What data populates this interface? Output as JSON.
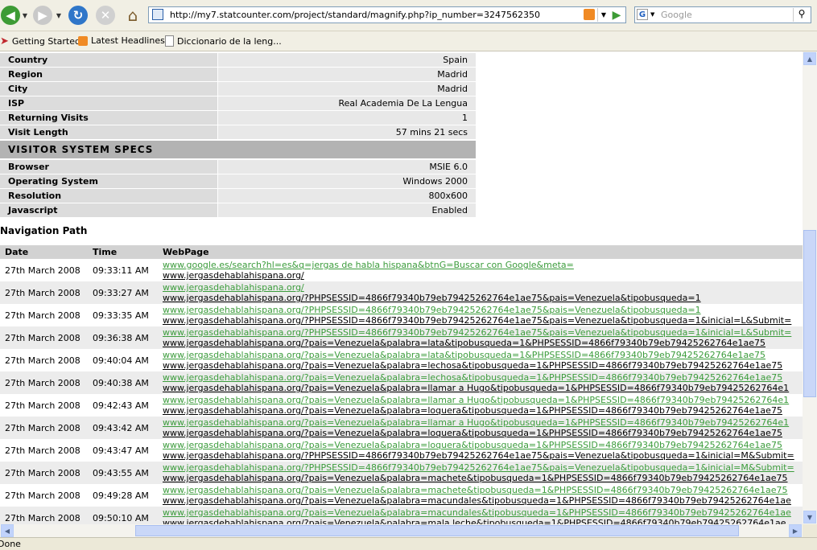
{
  "browser": {
    "url": "http://my7.statcounter.com/project/standard/magnify.php?ip_number=3247562350",
    "search_placeholder": "Google",
    "bookmarks": [
      "Getting Started",
      "Latest Headlines",
      "Diccionario de la leng..."
    ],
    "status": "Done"
  },
  "visitor_info": [
    {
      "label": "Country",
      "value": "Spain"
    },
    {
      "label": "Region",
      "value": "Madrid"
    },
    {
      "label": "City",
      "value": "Madrid"
    },
    {
      "label": "ISP",
      "value": "Real Academia De La Lengua"
    },
    {
      "label": "Returning Visits",
      "value": "1"
    },
    {
      "label": "Visit Length",
      "value": "57 mins 21 secs"
    }
  ],
  "system_specs": {
    "title": "VISITOR SYSTEM SPECS",
    "rows": [
      {
        "label": "Browser",
        "value": "MSIE 6.0"
      },
      {
        "label": "Operating System",
        "value": "Windows 2000"
      },
      {
        "label": "Resolution",
        "value": "800x600"
      },
      {
        "label": "Javascript",
        "value": "Enabled"
      }
    ]
  },
  "navigation": {
    "title": "Navigation Path",
    "columns": [
      "Date",
      "Time",
      "WebPage"
    ],
    "rows": [
      {
        "date": "27th March 2008",
        "time": "09:33:11 AM",
        "link1": "www.google.es/search?hl=es&q=jergas de habla hispana&btnG=Buscar con Google&meta=",
        "link2": "www.jergasdehablahispana.org/"
      },
      {
        "date": "27th March 2008",
        "time": "09:33:27 AM",
        "link1": "www.jergasdehablahispana.org/",
        "link2": "www.jergasdehablahispana.org/?PHPSESSID=4866f79340b79eb79425262764e1ae75&pais=Venezuela&tipobusqueda=1"
      },
      {
        "date": "27th March 2008",
        "time": "09:33:35 AM",
        "link1": "www.jergasdehablahispana.org/?PHPSESSID=4866f79340b79eb79425262764e1ae75&pais=Venezuela&tipobusqueda=1",
        "link2": "www.jergasdehablahispana.org/?PHPSESSID=4866f79340b79eb79425262764e1ae75&pais=Venezuela&tipobusqueda=1&inicial=L&Submit="
      },
      {
        "date": "27th March 2008",
        "time": "09:36:38 AM",
        "link1": "www.jergasdehablahispana.org/?PHPSESSID=4866f79340b79eb79425262764e1ae75&pais=Venezuela&tipobusqueda=1&inicial=L&Submit=",
        "link2": "www.jergasdehablahispana.org/?pais=Venezuela&palabra=lata&tipobusqueda=1&PHPSESSID=4866f79340b79eb79425262764e1ae75"
      },
      {
        "date": "27th March 2008",
        "time": "09:40:04 AM",
        "link1": "www.jergasdehablahispana.org/?pais=Venezuela&palabra=lata&tipobusqueda=1&PHPSESSID=4866f79340b79eb79425262764e1ae75",
        "link2": "www.jergasdehablahispana.org/?pais=Venezuela&palabra=lechosa&tipobusqueda=1&PHPSESSID=4866f79340b79eb79425262764e1ae75"
      },
      {
        "date": "27th March 2008",
        "time": "09:40:38 AM",
        "link1": "www.jergasdehablahispana.org/?pais=Venezuela&palabra=lechosa&tipobusqueda=1&PHPSESSID=4866f79340b79eb79425262764e1ae75",
        "link2": "www.jergasdehablahispana.org/?pais=Venezuela&palabra=llamar a Hugo&tipobusqueda=1&PHPSESSID=4866f79340b79eb79425262764e1"
      },
      {
        "date": "27th March 2008",
        "time": "09:42:43 AM",
        "link1": "www.jergasdehablahispana.org/?pais=Venezuela&palabra=llamar a Hugo&tipobusqueda=1&PHPSESSID=4866f79340b79eb79425262764e1",
        "link2": "www.jergasdehablahispana.org/?pais=Venezuela&palabra=loquera&tipobusqueda=1&PHPSESSID=4866f79340b79eb79425262764e1ae75"
      },
      {
        "date": "27th March 2008",
        "time": "09:43:42 AM",
        "link1": "www.jergasdehablahispana.org/?pais=Venezuela&palabra=llamar a Hugo&tipobusqueda=1&PHPSESSID=4866f79340b79eb79425262764e1",
        "link2": "www.jergasdehablahispana.org/?pais=Venezuela&palabra=loquera&tipobusqueda=1&PHPSESSID=4866f79340b79eb79425262764e1ae75"
      },
      {
        "date": "27th March 2008",
        "time": "09:43:47 AM",
        "link1": "www.jergasdehablahispana.org/?pais=Venezuela&palabra=loquera&tipobusqueda=1&PHPSESSID=4866f79340b79eb79425262764e1ae75",
        "link2": "www.jergasdehablahispana.org/?PHPSESSID=4866f79340b79eb79425262764e1ae75&pais=Venezuela&tipobusqueda=1&inicial=M&Submit="
      },
      {
        "date": "27th March 2008",
        "time": "09:43:55 AM",
        "link1": "www.jergasdehablahispana.org/?PHPSESSID=4866f79340b79eb79425262764e1ae75&pais=Venezuela&tipobusqueda=1&inicial=M&Submit=",
        "link2": "www.jergasdehablahispana.org/?pais=Venezuela&palabra=machete&tipobusqueda=1&PHPSESSID=4866f79340b79eb79425262764e1ae75"
      },
      {
        "date": "27th March 2008",
        "time": "09:49:28 AM",
        "link1": "www.jergasdehablahispana.org/?pais=Venezuela&palabra=machete&tipobusqueda=1&PHPSESSID=4866f79340b79eb79425262764e1ae75",
        "link2": "www.jergasdehablahispana.org/?pais=Venezuela&palabra=macundales&tipobusqueda=1&PHPSESSID=4866f79340b79eb79425262764e1ae"
      },
      {
        "date": "27th March 2008",
        "time": "09:50:10 AM",
        "link1": "www.jergasdehablahispana.org/?pais=Venezuela&palabra=macundales&tipobusqueda=1&PHPSESSID=4866f79340b79eb79425262764e1ae",
        "link2": "www.jergasdehablahispana.org/?pais=Venezuela&palabra=mala leche&tipobusqueda=1&PHPSESSID=4866f79340b79eb79425262764e1ae"
      }
    ]
  }
}
